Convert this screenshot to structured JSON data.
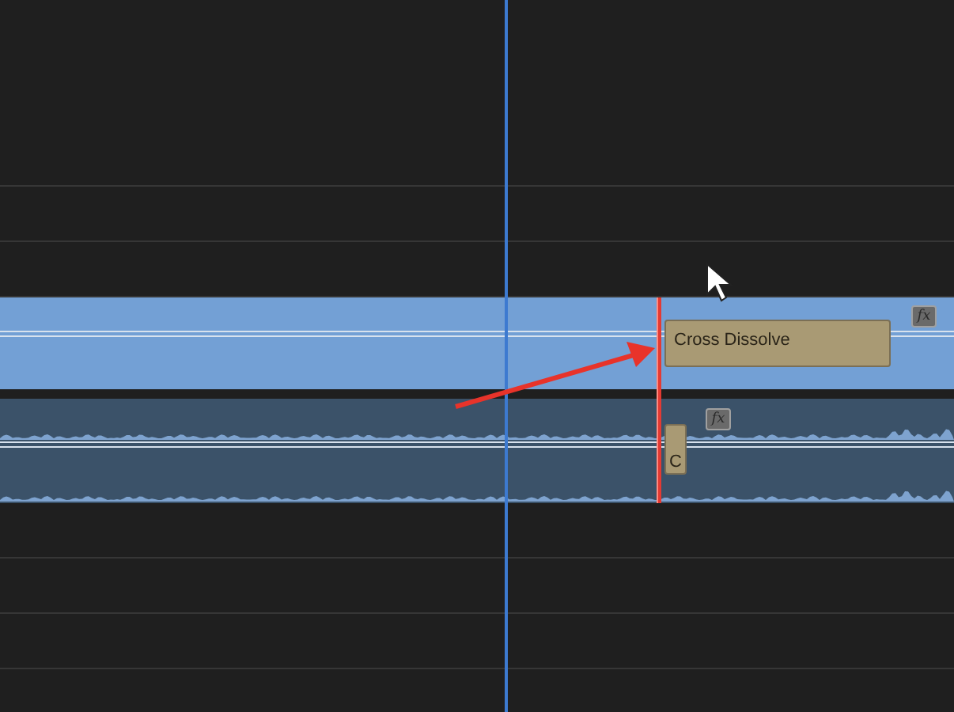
{
  "timeline": {
    "tracks": [
      {
        "kind": "empty"
      },
      {
        "kind": "empty"
      },
      {
        "kind": "video",
        "fx": "fx",
        "transition": {
          "label": "Cross Dissolve"
        }
      },
      {
        "kind": "audio",
        "fx": "fx",
        "transition": {
          "label": "C"
        }
      },
      {
        "kind": "empty"
      },
      {
        "kind": "empty"
      },
      {
        "kind": "empty"
      },
      {
        "kind": "empty"
      }
    ]
  }
}
